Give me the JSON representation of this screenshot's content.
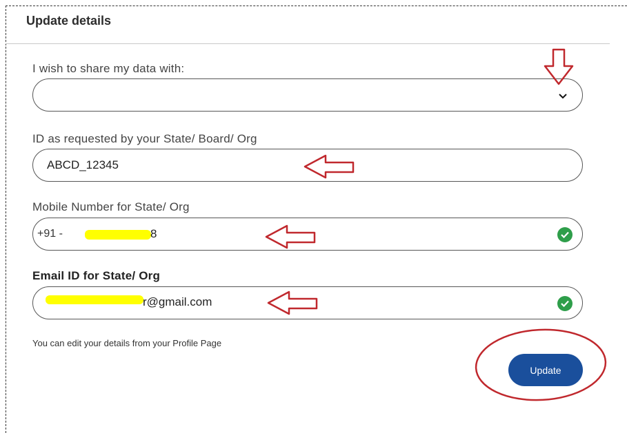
{
  "header": {
    "title": "Update details"
  },
  "share": {
    "label": "I wish to share my data with:",
    "value": ""
  },
  "state_id": {
    "label": "ID as requested by your State/ Board/ Org",
    "value": "ABCD_12345"
  },
  "mobile": {
    "label": "Mobile Number for State/ Org",
    "prefix": "+91 -",
    "visible_tail": "8"
  },
  "email": {
    "label": "Email ID for State/ Org",
    "visible_value": "r@gmail.com"
  },
  "hint": "You can edit your details from your Profile Page",
  "actions": {
    "update_label": "Update"
  },
  "colors": {
    "primary": "#1a4f9c",
    "success": "#2e9e4a",
    "annotation": "#c0282d",
    "highlight": "#ffff00"
  }
}
